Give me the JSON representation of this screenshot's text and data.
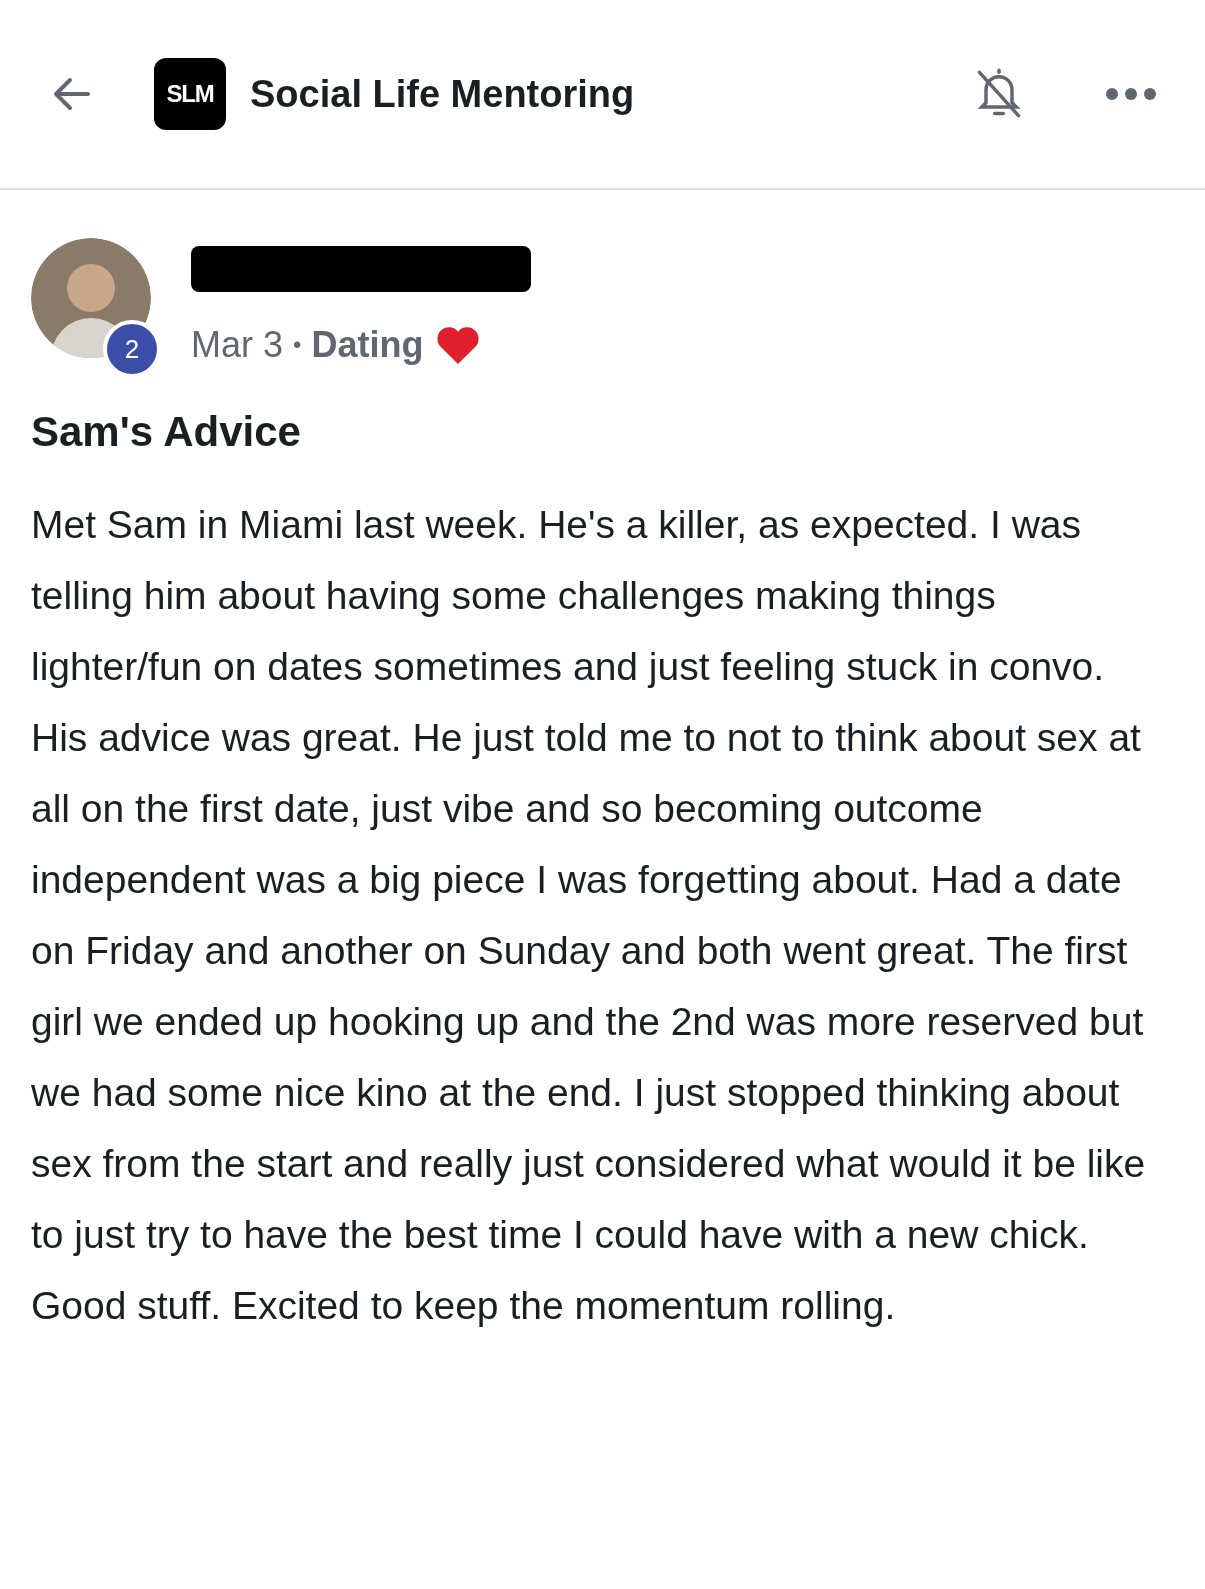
{
  "header": {
    "logo": "SLM",
    "title": "Social Life Mentoring"
  },
  "post": {
    "author_redacted": true,
    "badge": "2",
    "date": "Mar 3",
    "separator": "•",
    "category": "Dating",
    "title": "Sam's Advice",
    "body": "Met Sam in Miami last week. He's a killer, as expected. I was telling him about having some challenges making things lighter/fun on dates sometimes and just feeling stuck in convo. His advice was great. He just told me to not to think about sex at all on the first date, just vibe and so becoming outcome independent was a big piece I was forgetting about. Had a date on Friday and another on Sunday and both went great. The first girl we ended up hooking up and the 2nd was more reserved but we had some nice kino at the end. I just stopped thinking about sex from the start and really just considered what would it be like to just try to have the best time I could have with a new chick. Good stuff. Excited to keep the momentum rolling."
  }
}
